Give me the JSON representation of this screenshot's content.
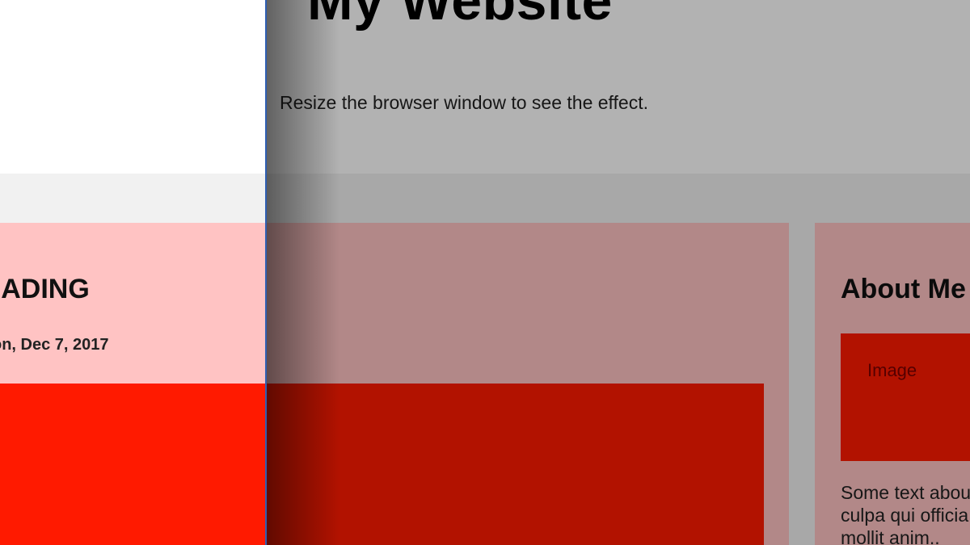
{
  "header": {
    "title": "My Website",
    "subtitle": "Resize the browser window to see the effect."
  },
  "post": {
    "heading": "HEADING",
    "date": "on, Dec 7, 2017"
  },
  "sidebar": {
    "about_title": "About Me",
    "image_label": "Image",
    "text": "Some text about\nculpa qui officia\nmollit anim.."
  },
  "colors": {
    "page_background": "#f1f1f1",
    "card_background": "#ffc3c3",
    "image_placeholder": "#ff1a00",
    "split_line": "#2f5fb3"
  }
}
